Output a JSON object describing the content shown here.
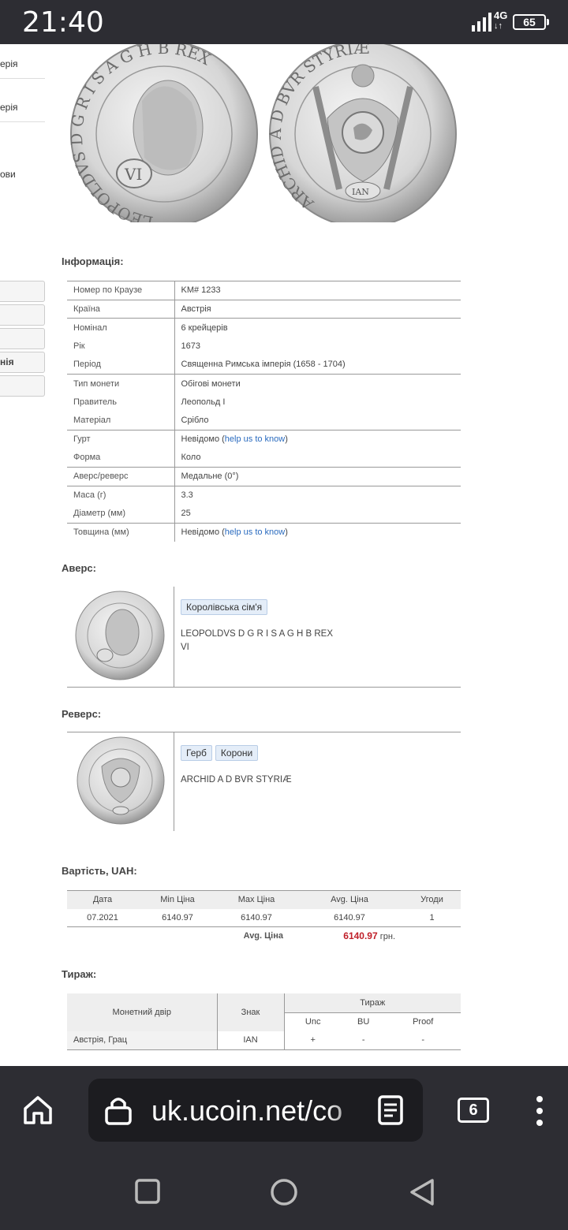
{
  "status": {
    "time": "21:40",
    "network": "4G",
    "battery": "65"
  },
  "sidebar": {
    "links": [
      "ерія",
      "ерія",
      "ови"
    ],
    "buttons": [
      "",
      "",
      "",
      "нія",
      ""
    ]
  },
  "info": {
    "title": "Інформація:",
    "rows": [
      {
        "k": "Номер по Краузе",
        "v": "KM# 1233"
      },
      {
        "k": "Країна",
        "v": "Австрія"
      },
      {
        "k": "Номінал",
        "v": "6 крейцерів"
      },
      {
        "k": "Рік",
        "v": "1673"
      },
      {
        "k": "Період",
        "v": "Священна Римська імперія (1658 - 1704)"
      },
      {
        "k": "Тип монети",
        "v": "Обігові монети"
      },
      {
        "k": "Правитель",
        "v": "Леопольд I"
      },
      {
        "k": "Матеріал",
        "v": "Срібло"
      },
      {
        "k": "Гурт",
        "v": "Невідомо (",
        "link": "help us to know",
        "after": ")"
      },
      {
        "k": "Форма",
        "v": "Коло"
      },
      {
        "k": "Аверс/реверс",
        "v": "Медальне (0°)"
      },
      {
        "k": "Маса (г)",
        "v": "3.3"
      },
      {
        "k": "Діаметр (мм)",
        "v": "25"
      },
      {
        "k": "Товщина (мм)",
        "v": "Невідомо (",
        "link": "help us to know",
        "after": ")"
      }
    ]
  },
  "coin": {
    "obverse_legend": "LEOPOLDVS D G R I S A G H B REX",
    "reverse_legend": "ARCHID A D BVR STYRIÆ",
    "mark": "IAN"
  },
  "obverse": {
    "title": "Аверс:",
    "tags": [
      "Королівська сім'я"
    ],
    "line1": "LEOPOLDVS D G R I S A G H B REX",
    "line2": "VI"
  },
  "reverse": {
    "title": "Реверс:",
    "tags": [
      "Герб",
      "Корони"
    ],
    "line1": "ARCHID A D BVR STYRIÆ"
  },
  "price": {
    "title": "Вартість, UAH:",
    "headers": [
      "Дата",
      "Min Ціна",
      "Max Ціна",
      "Avg. Ціна",
      "Угоди"
    ],
    "row": [
      "07.2021",
      "6140.97",
      "6140.97",
      "6140.97",
      "1"
    ],
    "avg_label": "Avg. Ціна",
    "avg_value": "6140.97",
    "currency": "грн."
  },
  "mintage": {
    "title": "Тираж:",
    "h_mint": "Монетний двір",
    "h_mark": "Знак",
    "h_mintage": "Тираж",
    "sub": [
      "Unc",
      "BU",
      "Proof"
    ],
    "row": [
      "Австрія, Грац",
      "IAN",
      "+",
      "-",
      "-"
    ]
  },
  "browser": {
    "url": "uk.ucoin.net/co",
    "tabs": "6"
  },
  "colors": {
    "bars": "#2d2d33",
    "link": "#2a6bbf",
    "avg_price": "#c0202a"
  }
}
